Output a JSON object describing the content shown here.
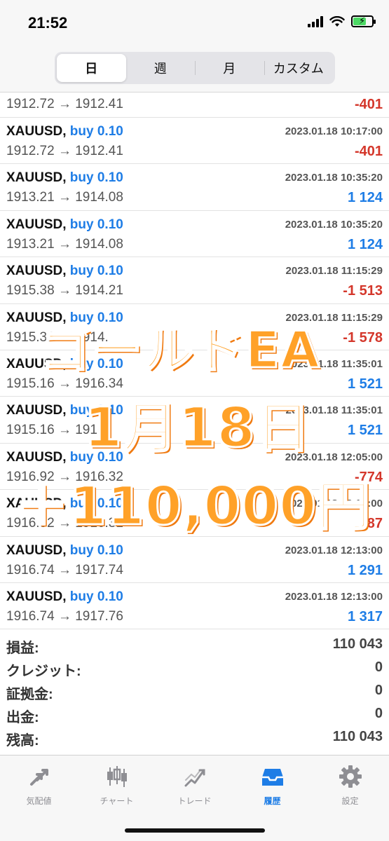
{
  "status_bar": {
    "time": "21:52"
  },
  "segments": [
    "日",
    "週",
    "月",
    "カスタム"
  ],
  "partial_row": {
    "prices": "1912.72 → 1912.41",
    "profit": "-401"
  },
  "deals": [
    {
      "symbol": "XAUUSD,",
      "type": "buy 0.10",
      "time": "2023.01.18 10:17:00",
      "prices": "1912.72 → 1912.41",
      "profit": "-401",
      "sign": "neg"
    },
    {
      "symbol": "XAUUSD,",
      "type": "buy 0.10",
      "time": "2023.01.18 10:35:20",
      "prices": "1913.21 → 1914.08",
      "profit": "1 124",
      "sign": "pos"
    },
    {
      "symbol": "XAUUSD,",
      "type": "buy 0.10",
      "time": "2023.01.18 10:35:20",
      "prices": "1913.21 → 1914.08",
      "profit": "1 124",
      "sign": "pos"
    },
    {
      "symbol": "XAUUSD,",
      "type": "buy 0.10",
      "time": "2023.01.18 11:15:29",
      "prices": "1915.38 → 1914.21",
      "profit": "-1 513",
      "sign": "neg"
    },
    {
      "symbol": "XAUUSD,",
      "type": "buy 0.10",
      "time": "2023.01.18 11:15:29",
      "prices": "1915.38 → 1914.",
      "profit": "-1 578",
      "sign": "neg"
    },
    {
      "symbol": "XAUUSD,",
      "type": "buy 0.10",
      "time": "2023.01.18 11:35:01",
      "prices": "1915.16 → 1916.34",
      "profit": "1 521",
      "sign": "pos"
    },
    {
      "symbol": "XAUUSD,",
      "type": "buy 0.10",
      "time": "2023.01.18 11:35:01",
      "prices": "1915.16 → 1916.",
      "profit": "1 521",
      "sign": "pos"
    },
    {
      "symbol": "XAUUSD,",
      "type": "buy 0.10",
      "time": "2023.01.18 12:05:00",
      "prices": "1916.92 → 1916.32",
      "profit": "-774",
      "sign": "neg"
    },
    {
      "symbol": "XAUUSD,",
      "type": "buy 0.10",
      "time": "2023.01.18 12:05:00",
      "prices": "1916.92 → 1916.31",
      "profit": "-787",
      "sign": "neg"
    },
    {
      "symbol": "XAUUSD,",
      "type": "buy 0.10",
      "time": "2023.01.18 12:13:00",
      "prices": "1916.74 → 1917.74",
      "profit": "1 291",
      "sign": "pos"
    },
    {
      "symbol": "XAUUSD,",
      "type": "buy 0.10",
      "time": "2023.01.18 12:13:00",
      "prices": "1916.74 → 1917.76",
      "profit": "1 317",
      "sign": "pos"
    }
  ],
  "summary": [
    {
      "label": "損益:",
      "value": "110 043"
    },
    {
      "label": "クレジット:",
      "value": "0"
    },
    {
      "label": "証拠金:",
      "value": "0"
    },
    {
      "label": "出金:",
      "value": "0"
    },
    {
      "label": "残高:",
      "value": "110 043"
    }
  ],
  "tabs": [
    {
      "label": "気配値",
      "icon": "quotes-icon"
    },
    {
      "label": "チャート",
      "icon": "chart-icon"
    },
    {
      "label": "トレード",
      "icon": "trade-icon"
    },
    {
      "label": "履歴",
      "icon": "history-icon"
    },
    {
      "label": "設定",
      "icon": "settings-icon"
    }
  ],
  "overlay": {
    "line1": "ゴールドEA",
    "line2": "1月18日",
    "line3": "＋110,000円"
  },
  "colors": {
    "accent": "#1e7de6",
    "negative": "#d4372b",
    "overlay": "#ffa128"
  }
}
